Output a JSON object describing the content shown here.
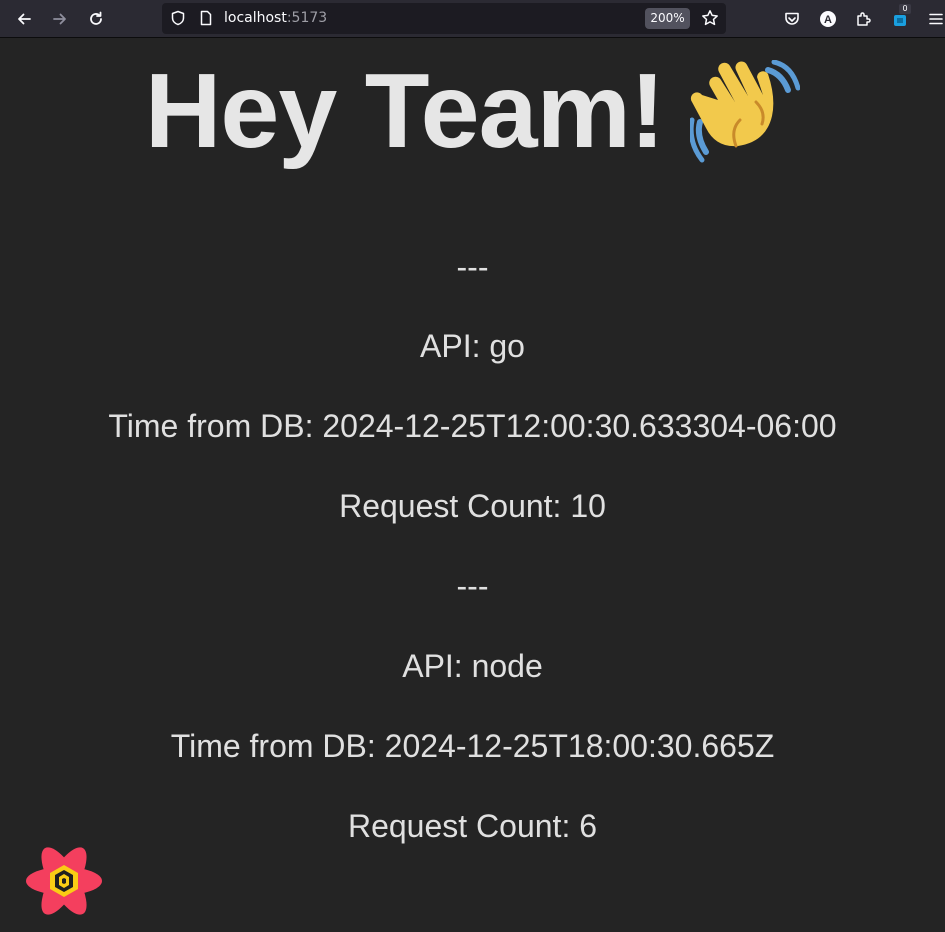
{
  "browser": {
    "url_host": "localhost",
    "url_port": ":5173",
    "zoom": "200%",
    "extension_badge_count": "0",
    "profile_initial": "A",
    "icons": {
      "back": "back-arrow-icon",
      "forward": "forward-arrow-icon",
      "reload": "reload-icon",
      "shield": "tracking-protection-shield-icon",
      "page": "page-info-icon",
      "bookmark": "bookmark-star-icon",
      "pocket": "pocket-icon",
      "account": "account-icon",
      "extensions": "extensions-puzzle-icon",
      "extension": "extension-icon",
      "menu": "hamburger-menu-icon"
    }
  },
  "page": {
    "title": "Hey Team!",
    "title_emoji": "waving-hand",
    "entries": [
      {
        "separator": "---",
        "api": "API: go",
        "time": "Time from DB: 2024-12-25T12:00:30.633304-06:00",
        "count": "Request Count: 10"
      },
      {
        "separator": "---",
        "api": "API: node",
        "time": "Time from DB: 2024-12-25T18:00:30.665Z",
        "count": "Request Count: 6"
      }
    ]
  },
  "colors": {
    "page_background": "#242424",
    "text": "#e6e6e6",
    "toolbar": "#2b2a33",
    "urlbar": "#1c1b22",
    "devtools_red": "#f43f5e",
    "devtools_yellow": "#facc15"
  }
}
